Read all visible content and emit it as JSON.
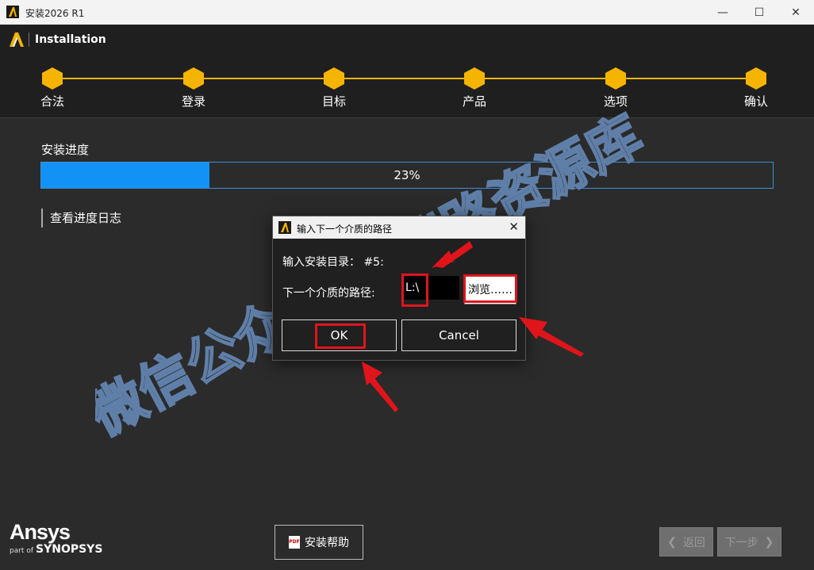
{
  "window": {
    "title": "安装2026 R1",
    "controls": {
      "minimize": "—",
      "maximize": "☐",
      "close": "✕"
    }
  },
  "header": {
    "title": "Installation"
  },
  "steps": [
    {
      "label": "合法"
    },
    {
      "label": "登录"
    },
    {
      "label": "目标"
    },
    {
      "label": "产品"
    },
    {
      "label": "选项"
    },
    {
      "label": "确认"
    }
  ],
  "progress": {
    "label": "安装进度",
    "percent_text": "23%",
    "value": 0.23
  },
  "log_link": "查看进度日志",
  "dialog": {
    "title": "输入下一个介质的路径",
    "close": "✕",
    "install_dir_label": "输入安装目录：  #5:",
    "next_media_label": "下一个介质的路径:",
    "path_value": "L:\\",
    "browse_label": "浏览……",
    "ok_label": "OK",
    "cancel_label": "Cancel"
  },
  "footer": {
    "brand": "Ansys",
    "brand_sub_prefix": "part of",
    "brand_sub": "SYNOPSYS",
    "help_label": "安装帮助",
    "back_label": "返回",
    "next_label": "下一步"
  },
  "colors": {
    "accent": "#f5b400",
    "progress": "#1292f4",
    "highlight": "#e0141b"
  },
  "watermark": "微信公众号:云端路资源库"
}
